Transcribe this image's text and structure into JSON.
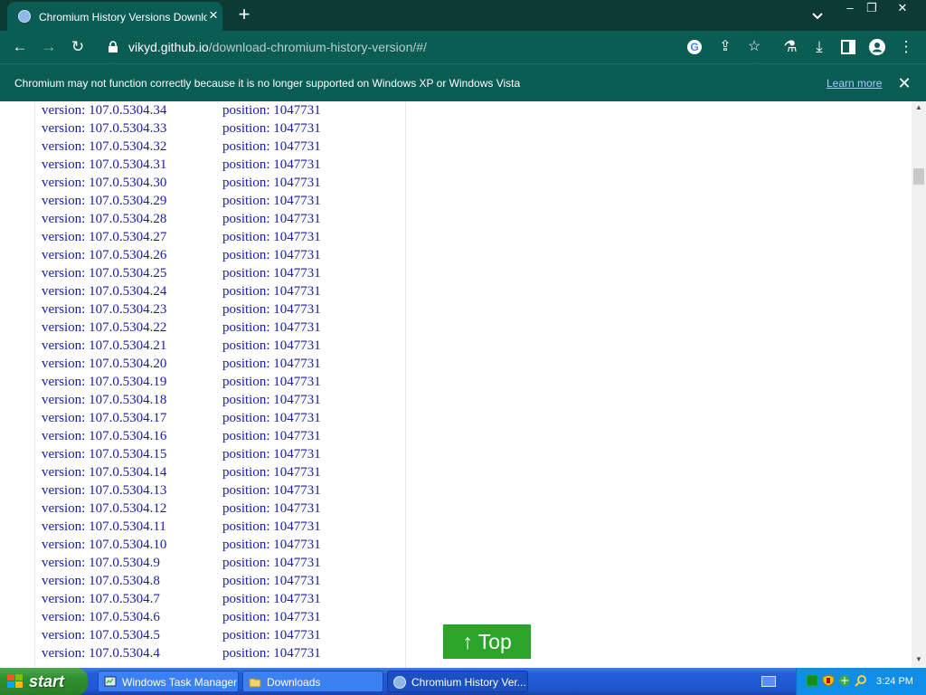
{
  "browser": {
    "tab_title": "Chromium History Versions Download",
    "url_host": "vikyd.github.io",
    "url_path": "/download-chromium-history-version/#/",
    "infobar_message": "Chromium may not function correctly because it is no longer supported on Windows XP or Windows Vista",
    "infobar_link": "Learn more",
    "accent": "#0b5c53"
  },
  "version_rows": [
    {
      "version": "version: 107.0.5304.34",
      "position": "position: 1047731"
    },
    {
      "version": "version: 107.0.5304.33",
      "position": "position: 1047731"
    },
    {
      "version": "version: 107.0.5304.32",
      "position": "position: 1047731"
    },
    {
      "version": "version: 107.0.5304.31",
      "position": "position: 1047731"
    },
    {
      "version": "version: 107.0.5304.30",
      "position": "position: 1047731"
    },
    {
      "version": "version: 107.0.5304.29",
      "position": "position: 1047731"
    },
    {
      "version": "version: 107.0.5304.28",
      "position": "position: 1047731"
    },
    {
      "version": "version: 107.0.5304.27",
      "position": "position: 1047731"
    },
    {
      "version": "version: 107.0.5304.26",
      "position": "position: 1047731"
    },
    {
      "version": "version: 107.0.5304.25",
      "position": "position: 1047731"
    },
    {
      "version": "version: 107.0.5304.24",
      "position": "position: 1047731"
    },
    {
      "version": "version: 107.0.5304.23",
      "position": "position: 1047731"
    },
    {
      "version": "version: 107.0.5304.22",
      "position": "position: 1047731"
    },
    {
      "version": "version: 107.0.5304.21",
      "position": "position: 1047731"
    },
    {
      "version": "version: 107.0.5304.20",
      "position": "position: 1047731"
    },
    {
      "version": "version: 107.0.5304.19",
      "position": "position: 1047731"
    },
    {
      "version": "version: 107.0.5304.18",
      "position": "position: 1047731"
    },
    {
      "version": "version: 107.0.5304.17",
      "position": "position: 1047731"
    },
    {
      "version": "version: 107.0.5304.16",
      "position": "position: 1047731"
    },
    {
      "version": "version: 107.0.5304.15",
      "position": "position: 1047731"
    },
    {
      "version": "version: 107.0.5304.14",
      "position": "position: 1047731"
    },
    {
      "version": "version: 107.0.5304.13",
      "position": "position: 1047731"
    },
    {
      "version": "version: 107.0.5304.12",
      "position": "position: 1047731"
    },
    {
      "version": "version: 107.0.5304.11",
      "position": "position: 1047731"
    },
    {
      "version": "version: 107.0.5304.10",
      "position": "position: 1047731"
    },
    {
      "version": "version: 107.0.5304.9",
      "position": "position: 1047731"
    },
    {
      "version": "version: 107.0.5304.8",
      "position": "position: 1047731"
    },
    {
      "version": "version: 107.0.5304.7",
      "position": "position: 1047731"
    },
    {
      "version": "version: 107.0.5304.6",
      "position": "position: 1047731"
    },
    {
      "version": "version: 107.0.5304.5",
      "position": "position: 1047731"
    },
    {
      "version": "version: 107.0.5304.4",
      "position": "position: 1047731"
    }
  ],
  "top_button": "↑ Top",
  "top_button_color": "#2aa52a",
  "taskbar": {
    "start_label": "start",
    "tasks": [
      {
        "label": "Windows Task Manager"
      },
      {
        "label": "Downloads"
      },
      {
        "label": "Chromium History Ver..."
      }
    ],
    "clock": "3:24 PM"
  }
}
